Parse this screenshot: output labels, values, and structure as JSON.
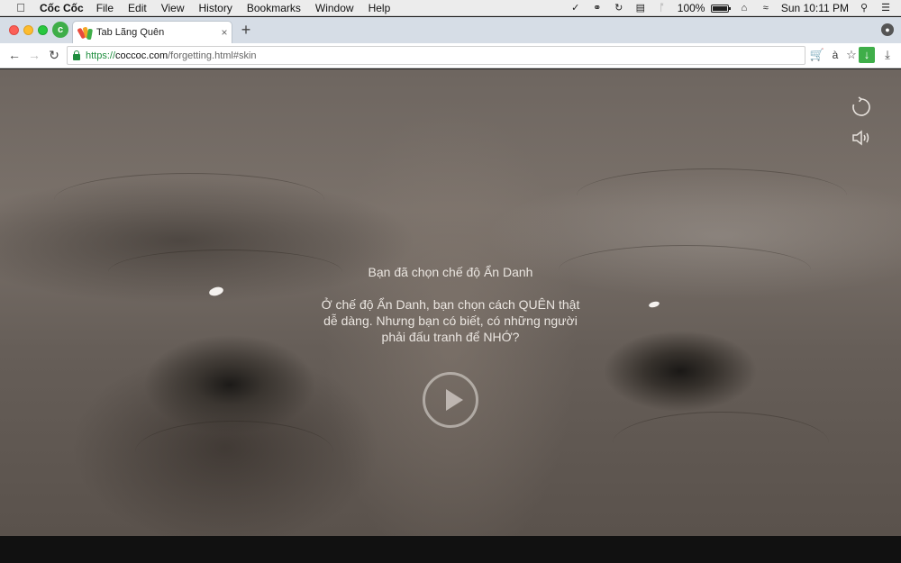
{
  "menubar": {
    "app_name": "Cốc Cốc",
    "items": [
      "File",
      "Edit",
      "View",
      "History",
      "Bookmarks",
      "Window",
      "Help"
    ],
    "battery": "100%",
    "battery_level": 1.0,
    "clock": "Sun 10:11 PM"
  },
  "browser": {
    "tab_title": "Tab Lãng Quên",
    "tab_close": "×",
    "new_tab": "+",
    "url": {
      "scheme": "https://",
      "host": "coccoc.com",
      "path": "/forgetting.html#skin"
    },
    "translate_label": "à"
  },
  "page": {
    "heading": "Bạn đã chọn chế độ Ẩn Danh",
    "body_line1": "Ở chế độ Ẩn Danh, bạn chọn cách QUÊN thật",
    "body_line2": "dễ dàng. Nhưng bạn có biết, có những người",
    "body_line3": "phải đấu tranh để NHỚ?"
  },
  "colors": {
    "brand_green": "#3fae49",
    "url_green": "#1e8e3e"
  }
}
